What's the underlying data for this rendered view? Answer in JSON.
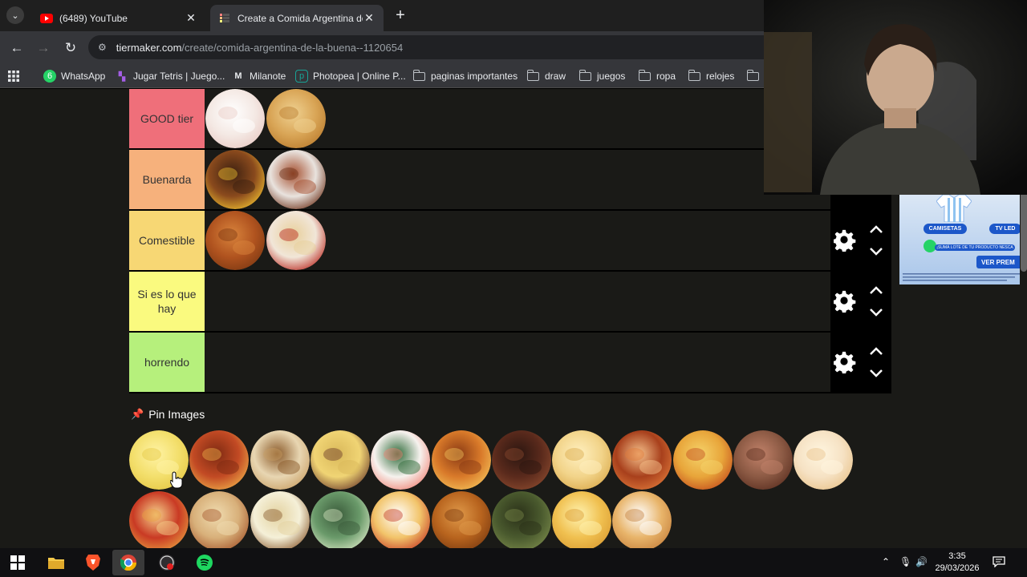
{
  "browser": {
    "tabs": [
      {
        "title": "(6489) YouTube",
        "active": false,
        "favicon": "youtube-icon"
      },
      {
        "title": "Create a Comida Argentina de l",
        "active": true,
        "favicon": "tiermaker-icon"
      }
    ],
    "url_host": "tiermaker.com",
    "url_path": "/create/comida-argentina-de-la-buena--1120654",
    "bookmarks": [
      {
        "label": "WhatsApp",
        "icon": "whatsapp-icon",
        "badge": "6"
      },
      {
        "label": "Jugar Tetris | Juego...",
        "icon": "tetris-icon"
      },
      {
        "label": "Milanote",
        "icon": "milanote-icon"
      },
      {
        "label": "Photopea | Online P...",
        "icon": "photopea-icon"
      },
      {
        "label": "paginas importantes",
        "icon": "folder-icon"
      },
      {
        "label": "draw",
        "icon": "folder-icon"
      },
      {
        "label": "juegos",
        "icon": "folder-icon"
      },
      {
        "label": "ropa",
        "icon": "folder-icon"
      },
      {
        "label": "relojes",
        "icon": "folder-icon"
      }
    ]
  },
  "tiers": [
    {
      "label": "GOOD tier",
      "color": "#ef6f7a",
      "items": [
        "sandwiches-de-miga",
        "empanadas"
      ]
    },
    {
      "label": "Buenarda",
      "color": "#f6b17c",
      "items": [
        "hamburguesa",
        "albondigas"
      ]
    },
    {
      "label": "Comestible",
      "color": "#f7d774",
      "items": [
        "guiso",
        "fideos-con-tuco"
      ]
    },
    {
      "label": "Si es lo que hay",
      "color": "#fafa7f",
      "items": []
    },
    {
      "label": "horrendo",
      "color": "#b6f07c",
      "items": []
    }
  ],
  "pin_images": {
    "title": "Pin Images",
    "row1": [
      "tallarines",
      "matambre-a-la-pizza",
      "canelones",
      "pastel-de-papa",
      "sushi",
      "lasagna",
      "asado",
      "chipa",
      "locro",
      "noquis",
      "bife",
      "fugazzeta"
    ],
    "row2": [
      "pizza",
      "choripan",
      "milanesa-pure",
      "tortilla",
      "ravioles",
      "pollo-asado",
      "sopa",
      "milanesa",
      "rabas"
    ]
  },
  "ad": {
    "label1": "CAMISETAS",
    "label2": "TV LED",
    "line": "¡SUMÁ LOTE DE TU PRODUCTO NESCA",
    "cta": "VER PREM"
  },
  "taskbar": {
    "time": "3:35",
    "date": "29/03/2026"
  },
  "colors": {
    "page_bg": "#1a1a17",
    "control_bg": "#000000"
  }
}
